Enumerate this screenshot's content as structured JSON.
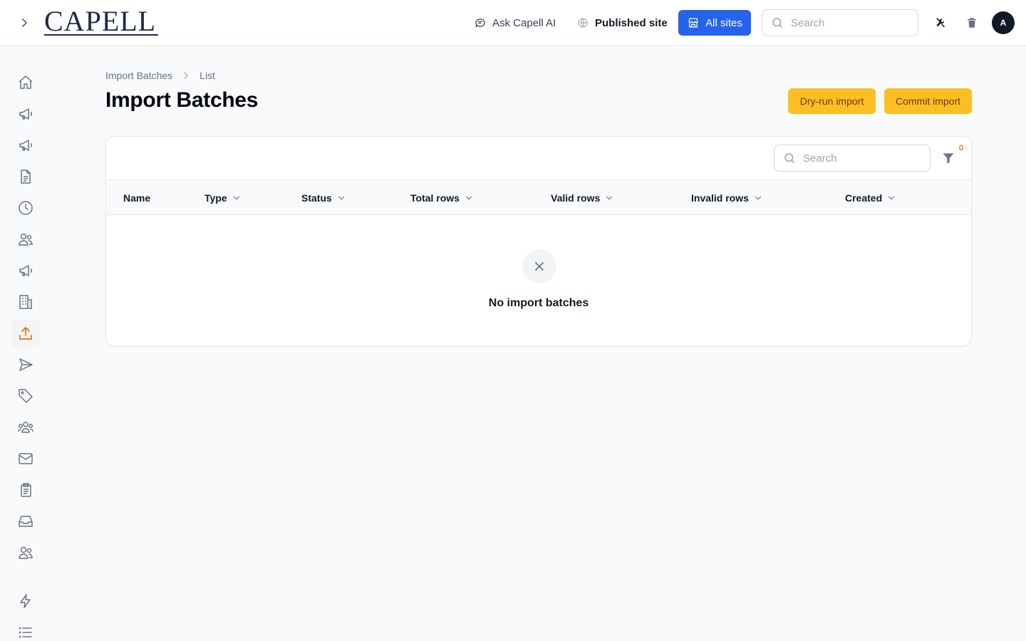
{
  "header": {
    "logo_text": "CAPELL",
    "ask_ai_label": "Ask Capell AI",
    "published_site_label": "Published site",
    "all_sites_label": "All sites",
    "search_placeholder": "Search",
    "avatar_initial": "A"
  },
  "breadcrumb": {
    "items": [
      "Import Batches",
      "List"
    ]
  },
  "page": {
    "title": "Import Batches",
    "dry_run_label": "Dry-run import",
    "commit_label": "Commit import"
  },
  "table": {
    "search_placeholder": "Search",
    "filter_count": "0",
    "columns": [
      "Name",
      "Type",
      "Status",
      "Total rows",
      "Valid rows",
      "Invalid rows",
      "Created"
    ],
    "empty_message": "No import batches"
  },
  "sidebar": {
    "icons": [
      "home-icon",
      "megaphone-icon",
      "megaphone-icon",
      "document-icon",
      "clock-icon",
      "users-icon",
      "megaphone-icon",
      "building-icon",
      "upload-icon",
      "paper-plane-icon",
      "tag-icon",
      "user-group-icon",
      "envelope-icon",
      "clipboard-icon",
      "inbox-icon",
      "users-icon",
      "bolt-icon",
      "list-icon"
    ],
    "active_icon": "upload-icon"
  },
  "colors": {
    "primary": "#2563eb",
    "amber": "#fbbf24",
    "active_icon": "#d97706"
  }
}
